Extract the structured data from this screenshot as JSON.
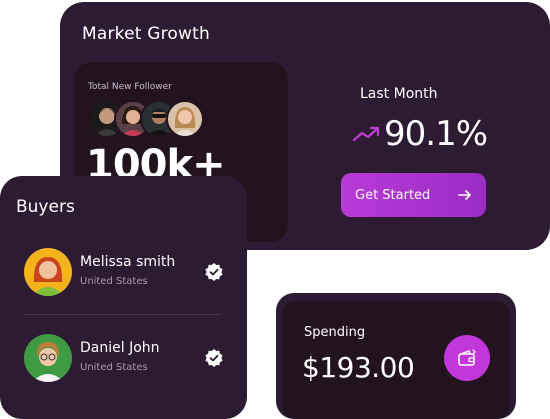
{
  "market": {
    "title": "Market Growth",
    "follower_label": "Total New Follower",
    "follower_count": "100k+",
    "period_label": "Last Month",
    "growth_pct": "90.1%",
    "cta_label": "Get Started",
    "accent": "#b93ad6"
  },
  "buyers": {
    "title": "Buyers",
    "items": [
      {
        "name": "Melissa smith",
        "location": "United States"
      },
      {
        "name": "Daniel John",
        "location": "United States"
      }
    ]
  },
  "spending": {
    "label": "Spending",
    "amount": "$193.00"
  },
  "icons": {
    "trend": "trend-up-icon",
    "arrow": "arrow-right-icon",
    "verified": "verified-badge-icon",
    "wallet": "wallet-icon"
  },
  "colors": {
    "card": "#2d1b33",
    "card_inner": "#22131f",
    "button": "#c237dc"
  }
}
